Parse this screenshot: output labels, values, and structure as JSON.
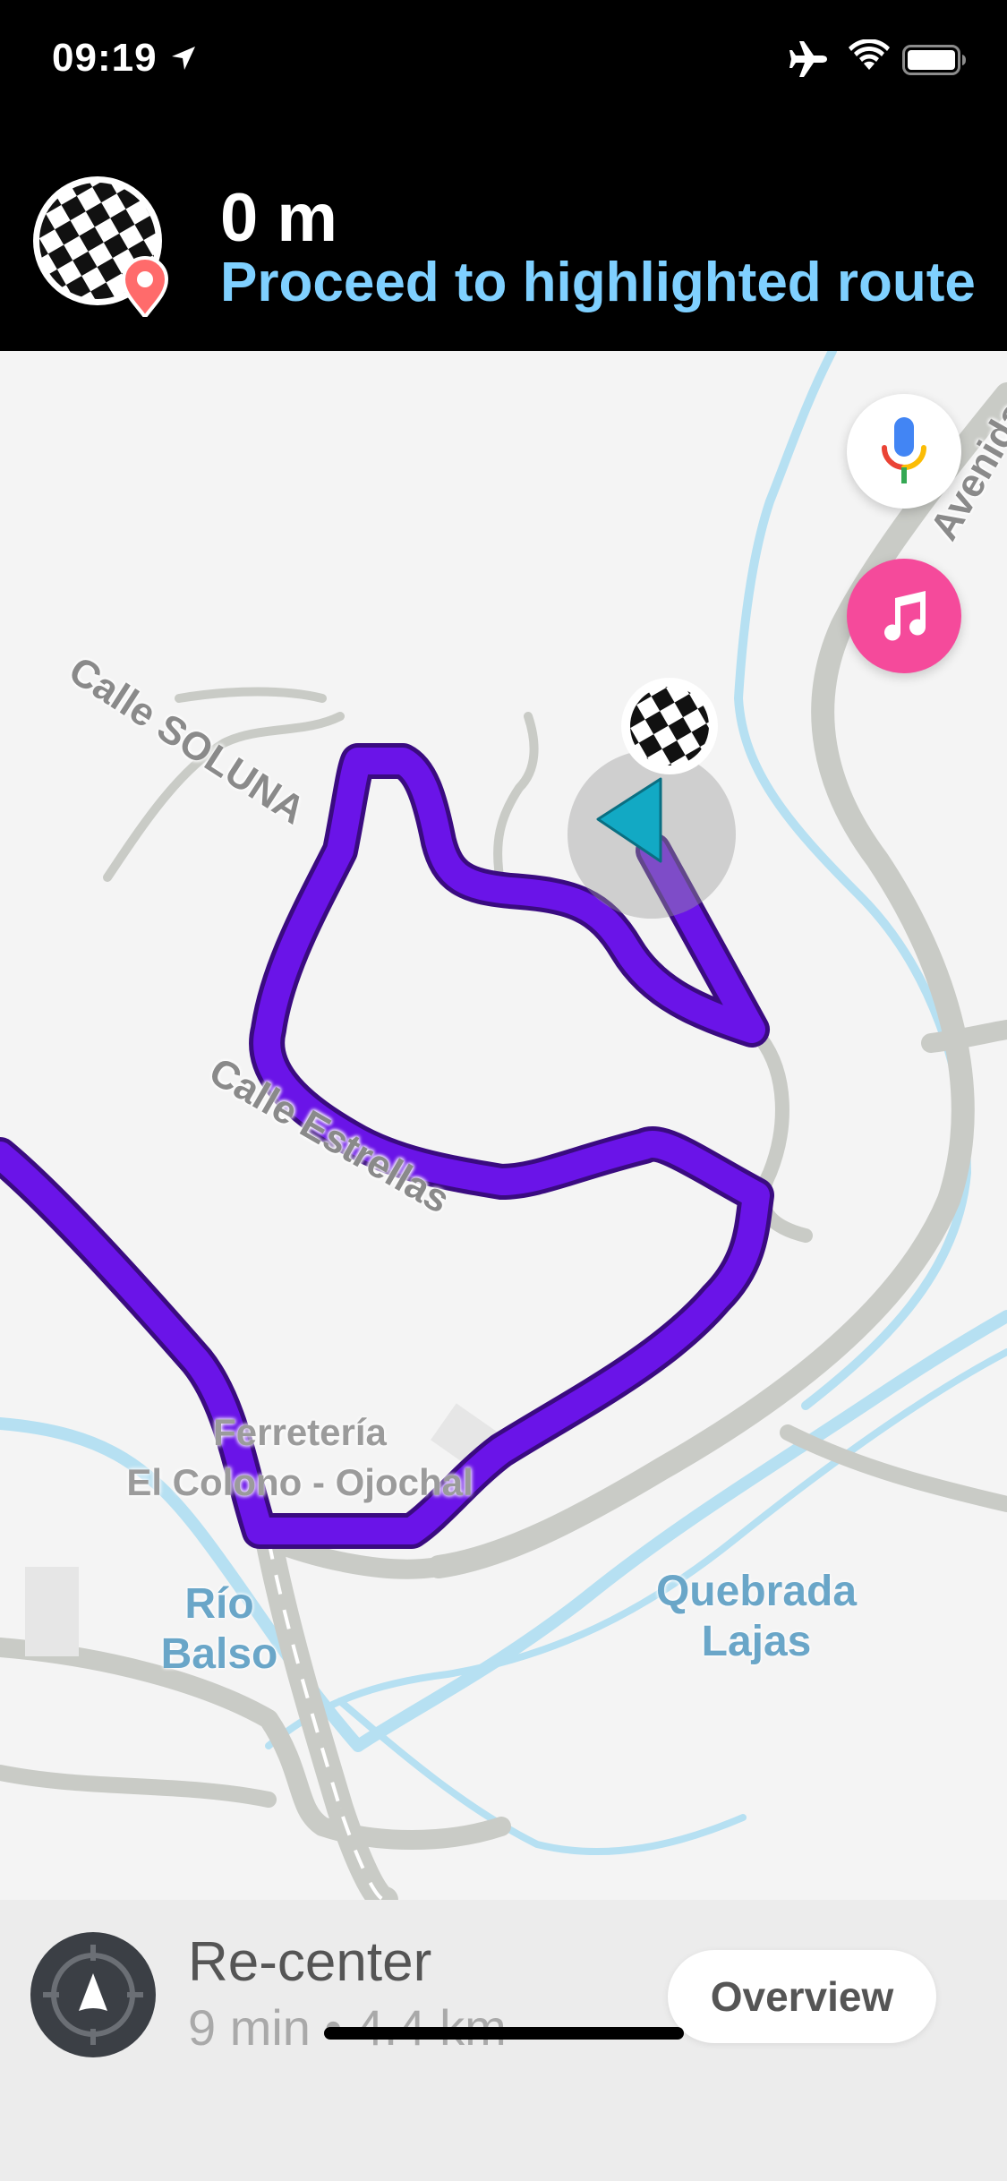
{
  "status_bar": {
    "time": "09:19",
    "icons": [
      "location-arrow-icon",
      "airplane-icon",
      "wifi-icon",
      "battery-icon"
    ]
  },
  "header": {
    "distance": "0 m",
    "instruction": "Proceed to highlighted route",
    "instruction_color": "#7fd0ff",
    "icon": "checkered-flag-pin-icon"
  },
  "map": {
    "street_labels": {
      "soluna": "Calle SOLUNA",
      "estrellas": "Calle Estrellas",
      "avenida": "Avenida P"
    },
    "poi": {
      "line1": "Ferretería",
      "line2": "El Colono - Ojochal"
    },
    "water_labels": {
      "rio_line1": "Río",
      "rio_line2": "Balso",
      "quebrada_line1": "Quebrada",
      "quebrada_line2": "Lajas"
    },
    "route_color": "#6a14e8",
    "water_color": "#b6e0f2",
    "road_color": "#c9cbc6",
    "vehicle_color": "#12a9c4"
  },
  "buttons": {
    "mic": "google-mic-icon",
    "music": "music-note-icon",
    "music_color": "#f54a9b"
  },
  "bottom": {
    "recenter_label": "Re-center",
    "trip_info": "9 min • 4.4 km",
    "overview_label": "Overview"
  }
}
